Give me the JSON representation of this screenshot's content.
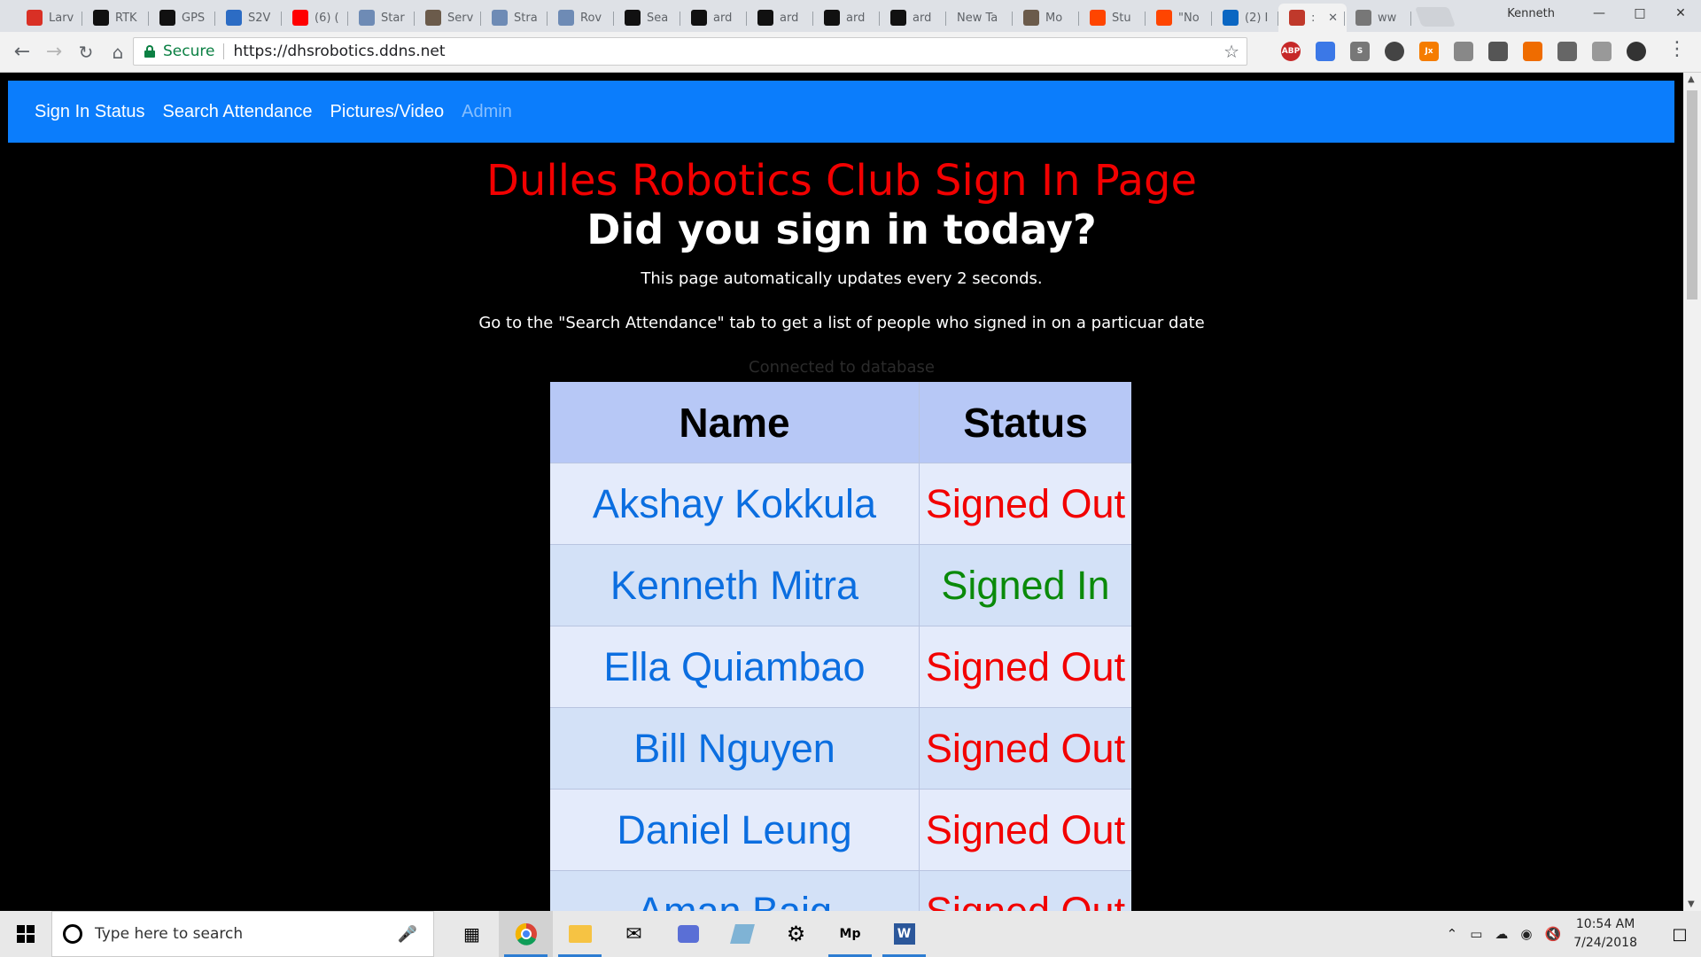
{
  "browser": {
    "tabs": [
      {
        "label": "Larv",
        "icon": "gmail-icon",
        "color": "#d93025"
      },
      {
        "label": "RTK",
        "icon": "app-icon",
        "color": "#111111"
      },
      {
        "label": "GPS",
        "icon": "app-icon",
        "color": "#111111"
      },
      {
        "label": "S2V",
        "icon": "dots-icon",
        "color": "#2c6cc4"
      },
      {
        "label": "(6) (",
        "icon": "youtube-icon",
        "color": "#ff0000"
      },
      {
        "label": "Star",
        "icon": "doc-icon",
        "color": "#6e8bb5"
      },
      {
        "label": "Serv",
        "icon": "gear-icon",
        "color": "#6b5b4b"
      },
      {
        "label": "Stra",
        "icon": "doc-icon",
        "color": "#6e8bb5"
      },
      {
        "label": "Rov",
        "icon": "doc-icon",
        "color": "#6e8bb5"
      },
      {
        "label": "Sea",
        "icon": "github-icon",
        "color": "#111111"
      },
      {
        "label": "ard",
        "icon": "github-icon",
        "color": "#111111"
      },
      {
        "label": "ard",
        "icon": "github-icon",
        "color": "#111111"
      },
      {
        "label": "ard",
        "icon": "github-icon",
        "color": "#111111"
      },
      {
        "label": "ard",
        "icon": "github-icon",
        "color": "#111111"
      },
      {
        "label": "New Ta",
        "icon": "",
        "color": ""
      },
      {
        "label": "Mo",
        "icon": "gear-icon",
        "color": "#6b5b4b"
      },
      {
        "label": "Stu",
        "icon": "reddit-icon",
        "color": "#ff4500"
      },
      {
        "label": "\"No",
        "icon": "reddit-icon",
        "color": "#ff4500"
      },
      {
        "label": "(2) I",
        "icon": "linkedin-icon",
        "color": "#0a66c2"
      },
      {
        "label": ":",
        "icon": "app-icon",
        "color": "#c0392b",
        "active": true
      },
      {
        "label": "ww",
        "icon": "loading-icon",
        "color": "#777777"
      }
    ],
    "profile_name": "Kenneth",
    "secure_label": "Secure",
    "url": "https://dhsrobotics.ddns.net"
  },
  "site": {
    "nav": [
      {
        "label": "Sign In Status",
        "muted": false
      },
      {
        "label": "Search Attendance",
        "muted": false
      },
      {
        "label": "Pictures/Video",
        "muted": false
      },
      {
        "label": "Admin",
        "muted": true
      }
    ],
    "title": "Dulles Robotics Club Sign In Page",
    "question": "Did you sign in today?",
    "update_note": "This page automatically updates every 2 seconds.",
    "search_note": "Go to the \"Search Attendance\" tab to get a list of people who signed in on a particuar date",
    "connection_status": "Connected to database",
    "table": {
      "headers": [
        "Name",
        "Status"
      ],
      "rows": [
        {
          "name": "Akshay Kokkula",
          "status": "Signed Out"
        },
        {
          "name": "Kenneth Mitra",
          "status": "Signed In"
        },
        {
          "name": "Ella Quiambao",
          "status": "Signed Out"
        },
        {
          "name": "Bill Nguyen",
          "status": "Signed Out"
        },
        {
          "name": "Daniel Leung",
          "status": "Signed Out"
        },
        {
          "name": "Aman Baig",
          "status": "Signed Out"
        }
      ]
    },
    "colors": {
      "navbar": "#0b7dfc",
      "title": "#f20000",
      "signed_in": "#0a8a0a",
      "signed_out": "#f20000",
      "name": "#0b6ee0"
    }
  },
  "taskbar": {
    "search_placeholder": "Type here to search",
    "time": "10:54 AM",
    "date": "7/24/2018"
  }
}
